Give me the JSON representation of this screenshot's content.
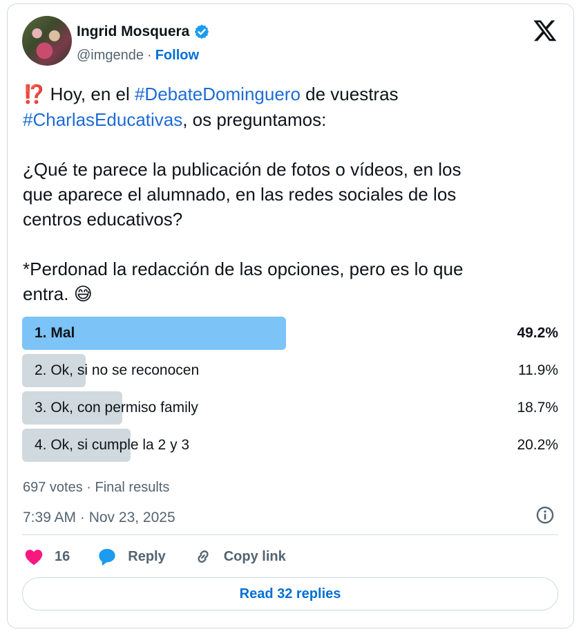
{
  "author": {
    "name": "Ingrid Mosquera",
    "handle": "@imgende",
    "separator": "·",
    "follow_label": "Follow"
  },
  "tweet": {
    "segments": [
      {
        "type": "emoji",
        "text": "⁉️"
      },
      {
        "type": "text",
        "text": " Hoy, en el "
      },
      {
        "type": "hashtag",
        "text": "#DebateDominguero"
      },
      {
        "type": "text",
        "text": " de vuestras\n"
      },
      {
        "type": "hashtag",
        "text": "#CharlasEducativas"
      },
      {
        "type": "text",
        "text": ", os preguntamos:\n\n¿Qué te parece la publicación de fotos o vídeos, en los\nque aparece el alumnado, en las redes sociales de los\ncentros educativos?\n\n*Perdonad la redacción de las opciones, pero es lo que\nentra. "
      },
      {
        "type": "emoji",
        "text": "😅"
      }
    ]
  },
  "poll": {
    "options": [
      {
        "label": "1. Mal",
        "percent_text": "49.2%",
        "percent": 49.2,
        "winner": true
      },
      {
        "label": "2. Ok, si no se reconocen",
        "percent_text": "11.9%",
        "percent": 11.9,
        "winner": false
      },
      {
        "label": "3. Ok, con permiso family",
        "percent_text": "18.7%",
        "percent": 18.7,
        "winner": false
      },
      {
        "label": "4. Ok, si cumple la 2 y 3",
        "percent_text": "20.2%",
        "percent": 20.2,
        "winner": false
      }
    ],
    "summary": "697 votes · Final results"
  },
  "timestamp": "7:39 AM · Nov 23, 2025",
  "actions": {
    "like_count": "16",
    "reply_label": "Reply",
    "copy_link_label": "Copy link"
  },
  "read_replies_label": "Read 32 replies",
  "colors": {
    "link": "#006fd6",
    "winner_bar": "#7cc3f7",
    "loser_bar": "#cfd9de",
    "heart": "#f91880",
    "verified": "#1d9bf0"
  },
  "icons": [
    "verified-badge-icon",
    "x-logo-icon",
    "info-icon",
    "heart-icon",
    "reply-bubble-icon",
    "link-icon"
  ]
}
